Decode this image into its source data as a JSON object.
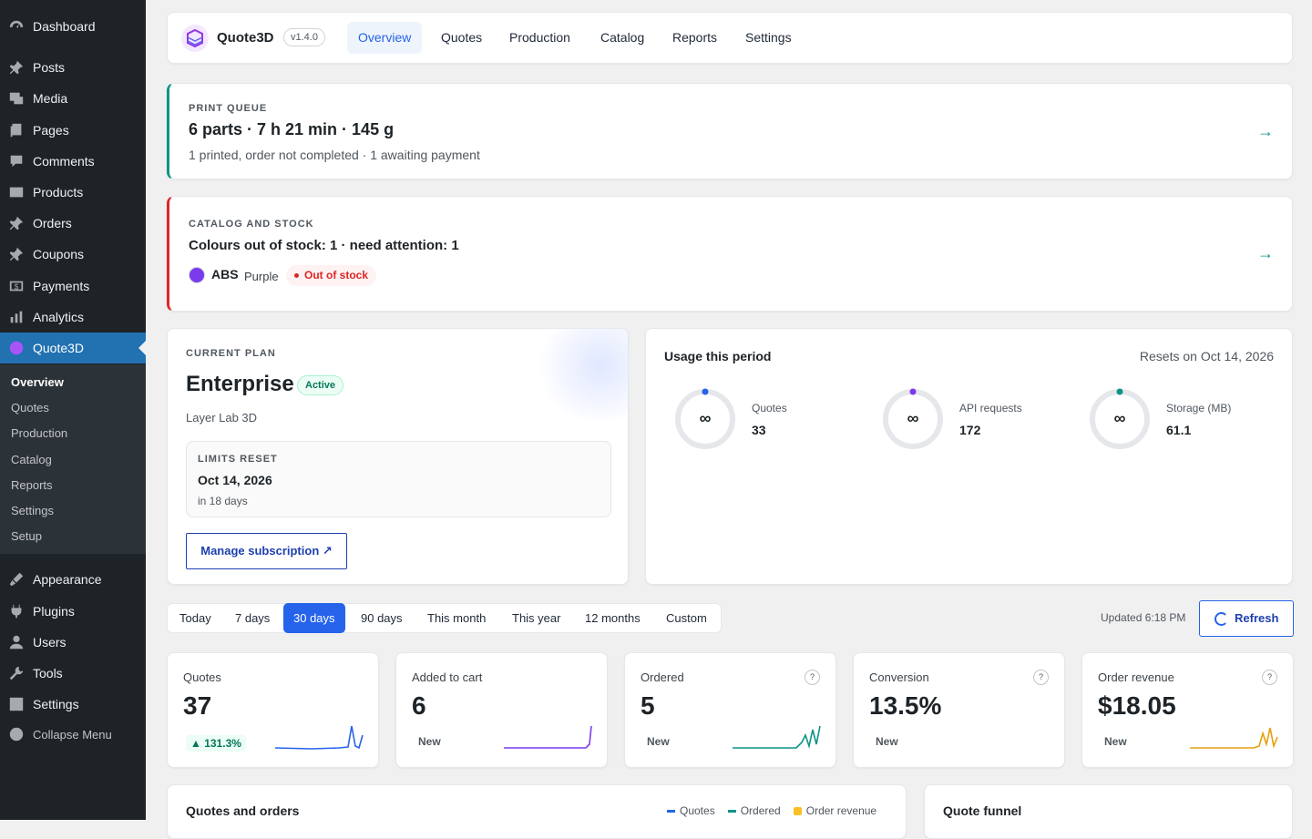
{
  "sidebar": {
    "dashboard": "Dashboard",
    "posts": "Posts",
    "media": "Media",
    "pages": "Pages",
    "comments": "Comments",
    "products": "Products",
    "orders": "Orders",
    "coupons": "Coupons",
    "payments": "Payments",
    "analytics": "Analytics",
    "quote3d": "Quote3D",
    "appearance": "Appearance",
    "plugins": "Plugins",
    "users": "Users",
    "tools": "Tools",
    "settings": "Settings",
    "collapse": "Collapse Menu",
    "sub": [
      "Overview",
      "Quotes",
      "Production",
      "Catalog",
      "Reports",
      "Settings",
      "Setup"
    ]
  },
  "header": {
    "app": "Quote3D",
    "version": "v1.4.0",
    "tabs": [
      "Overview",
      "Quotes",
      "Production",
      "Catalog",
      "Reports",
      "Settings"
    ]
  },
  "queue": {
    "eyebrow": "PRINT QUEUE",
    "title": "6 parts · 7 h 21 min · 145 g",
    "sub": "1 printed, order not completed · 1 awaiting payment"
  },
  "stock": {
    "eyebrow": "CATALOG AND STOCK",
    "title": "Colours out of stock: 1 · need attention: 1",
    "material": "ABS",
    "colour": "Purple",
    "status": "Out of stock",
    "swatch": "#7c3aed"
  },
  "plan": {
    "eyebrow": "CURRENT PLAN",
    "name": "Enterprise",
    "status": "Active",
    "company": "Layer Lab 3D",
    "reset_label": "LIMITS RESET",
    "reset_date": "Oct 14, 2026",
    "reset_in": "in 18 days",
    "manage": "Manage subscription ↗"
  },
  "usage": {
    "title": "Usage this period",
    "resets": "Resets on Oct 14, 2026",
    "items": [
      {
        "label": "Quotes",
        "value": "33",
        "symbol": "∞",
        "color": "#2563eb"
      },
      {
        "label": "API requests",
        "value": "172",
        "symbol": "∞",
        "color": "#7c3aed"
      },
      {
        "label": "Storage (MB)",
        "value": "61.1",
        "symbol": "∞",
        "color": "#0d9488"
      }
    ]
  },
  "range": {
    "tabs": [
      "Today",
      "7 days",
      "30 days",
      "90 days",
      "This month",
      "This year",
      "12 months",
      "Custom"
    ],
    "updated": "Updated 6:18 PM",
    "refresh": "Refresh"
  },
  "stats": [
    {
      "label": "Quotes",
      "value": "37",
      "badge": "▲ 131.3%",
      "color": "#2563eb"
    },
    {
      "label": "Added to cart",
      "value": "6",
      "badge": "New",
      "color": "#7c3aed"
    },
    {
      "label": "Ordered",
      "value": "5",
      "badge": "New",
      "color": "#0d9488"
    },
    {
      "label": "Conversion",
      "value": "13.5%",
      "badge": "New",
      "color": "#0d9488"
    },
    {
      "label": "Order revenue",
      "value": "$18.05",
      "badge": "New",
      "color": "#e5a00d"
    }
  ],
  "bottom": {
    "chart_title": "Quotes and orders",
    "legend": [
      "Quotes",
      "Ordered",
      "Order revenue"
    ],
    "funnel_title": "Quote funnel"
  }
}
